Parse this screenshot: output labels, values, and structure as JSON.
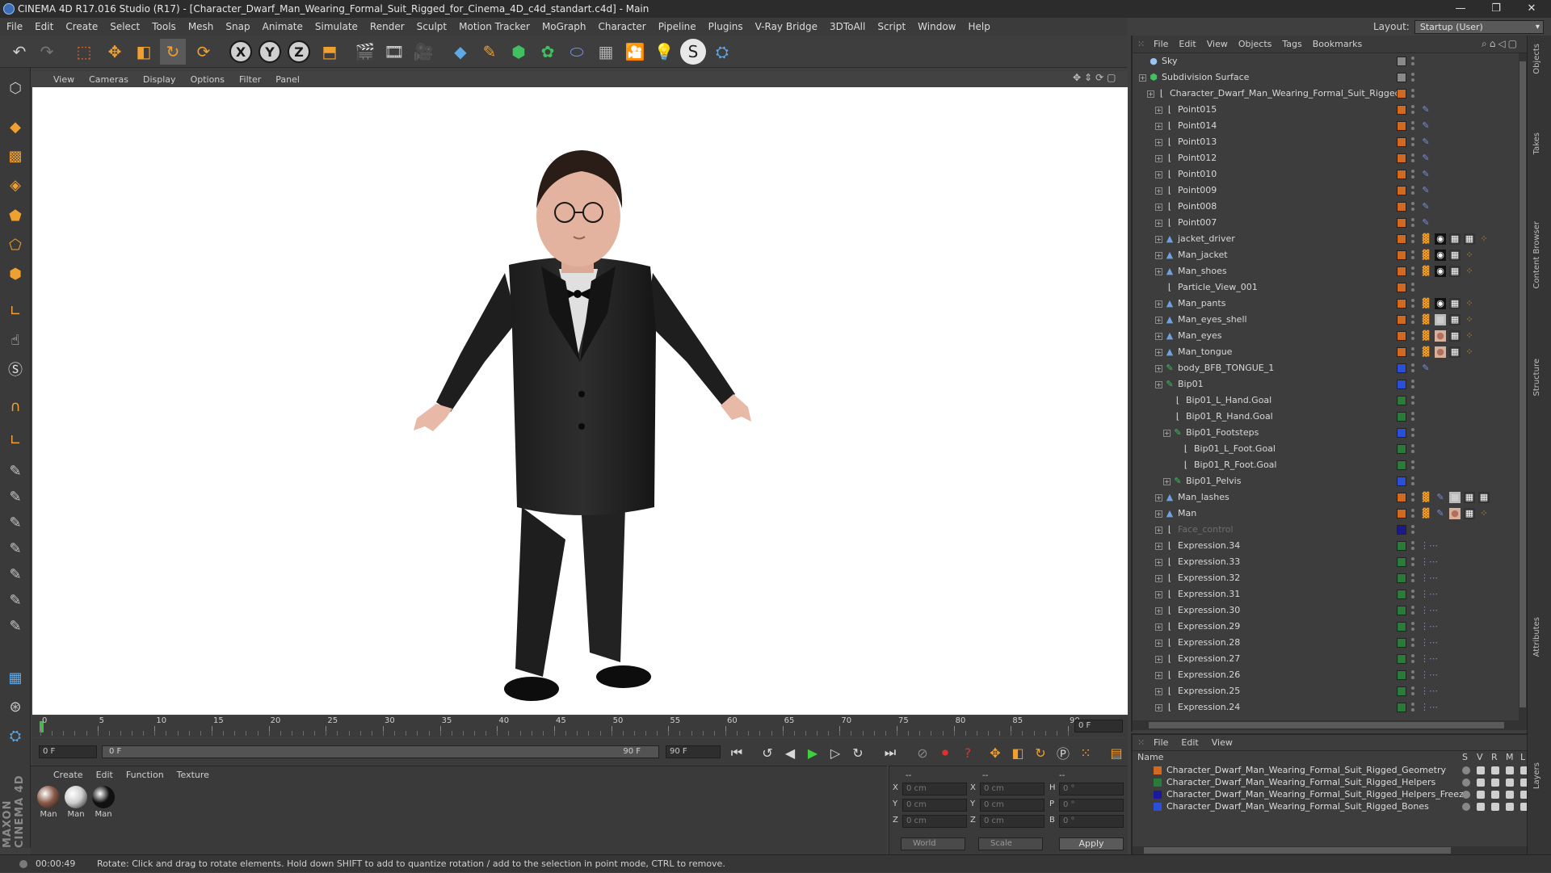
{
  "title_bar": {
    "text": "CINEMA 4D R17.016 Studio (R17) - [Character_Dwarf_Man_Wearing_Formal_Suit_Rigged_for_Cinema_4D_c4d_standart.c4d] - Main"
  },
  "menu": [
    "File",
    "Edit",
    "Create",
    "Select",
    "Tools",
    "Mesh",
    "Snap",
    "Animate",
    "Simulate",
    "Render",
    "Sculpt",
    "Motion Tracker",
    "MoGraph",
    "Character",
    "Pipeline",
    "Plugins",
    "V-Ray Bridge",
    "3DToAll",
    "Script",
    "Window",
    "Help"
  ],
  "layout": {
    "label": "Layout:",
    "value": "Startup (User)"
  },
  "viewport_menu": [
    "View",
    "Cameras",
    "Display",
    "Options",
    "Filter",
    "Panel"
  ],
  "axis_buttons": [
    "X",
    "Y",
    "Z"
  ],
  "timeline": {
    "ticks": [
      "0",
      "5",
      "10",
      "15",
      "20",
      "25",
      "30",
      "35",
      "40",
      "45",
      "50",
      "55",
      "60",
      "65",
      "70",
      "75",
      "80",
      "85",
      "90"
    ],
    "current_frame_field": "0 F"
  },
  "transport": {
    "start_field": "0 F",
    "slider_start": "0 F",
    "slider_end": "90 F",
    "end_field": "90 F"
  },
  "material_manager": {
    "menu": [
      "Create",
      "Edit",
      "Function",
      "Texture"
    ],
    "materials": [
      {
        "label": "Man",
        "color": "#8a5a48"
      },
      {
        "label": "Man",
        "color": "#cfcfcf"
      },
      {
        "label": "Man",
        "color": "#111111"
      }
    ]
  },
  "coordinates": {
    "header_left": "--",
    "header_mid": "--",
    "header_right": "--",
    "rows": [
      {
        "a": "X",
        "av": "0 cm",
        "b": "X",
        "bv": "0 cm",
        "c": "H",
        "cv": "0 °"
      },
      {
        "a": "Y",
        "av": "0 cm",
        "b": "Y",
        "bv": "0 cm",
        "c": "P",
        "cv": "0 °"
      },
      {
        "a": "Z",
        "av": "0 cm",
        "b": "Z",
        "bv": "0 cm",
        "c": "B",
        "cv": "0 °"
      }
    ],
    "mode": "World",
    "scale": "Scale",
    "apply": "Apply"
  },
  "object_manager": {
    "menu": [
      "File",
      "Edit",
      "View",
      "Objects",
      "Tags",
      "Bookmarks"
    ],
    "rows": [
      {
        "name": "Sky",
        "indent": 0,
        "icon": "sky",
        "layer": "",
        "exp": false
      },
      {
        "name": "Subdivision Surface",
        "indent": 0,
        "icon": "subd",
        "layer": "",
        "exp": true
      },
      {
        "name": "Character_Dwarf_Man_Wearing_Formal_Suit_Rigged",
        "indent": 1,
        "icon": "null",
        "layer": "#d2691e",
        "exp": true
      },
      {
        "name": "Point015",
        "indent": 2,
        "icon": "null",
        "layer": "#d2691e",
        "exp": true,
        "tags": [
          "ik"
        ]
      },
      {
        "name": "Point014",
        "indent": 2,
        "icon": "null",
        "layer": "#d2691e",
        "exp": true,
        "tags": [
          "ik"
        ]
      },
      {
        "name": "Point013",
        "indent": 2,
        "icon": "null",
        "layer": "#d2691e",
        "exp": true,
        "tags": [
          "ik"
        ]
      },
      {
        "name": "Point012",
        "indent": 2,
        "icon": "null",
        "layer": "#d2691e",
        "exp": true,
        "tags": [
          "ik"
        ]
      },
      {
        "name": "Point010",
        "indent": 2,
        "icon": "null",
        "layer": "#d2691e",
        "exp": true,
        "tags": [
          "ik"
        ]
      },
      {
        "name": "Point009",
        "indent": 2,
        "icon": "null",
        "layer": "#d2691e",
        "exp": true,
        "tags": [
          "ik"
        ]
      },
      {
        "name": "Point008",
        "indent": 2,
        "icon": "null",
        "layer": "#d2691e",
        "exp": true,
        "tags": [
          "ik"
        ]
      },
      {
        "name": "Point007",
        "indent": 2,
        "icon": "null",
        "layer": "#d2691e",
        "exp": true,
        "tags": [
          "ik"
        ]
      },
      {
        "name": "jacket_driver",
        "indent": 2,
        "icon": "poly",
        "layer": "#d2691e",
        "exp": true,
        "tags": [
          "w",
          "b",
          "k",
          "k",
          "o"
        ]
      },
      {
        "name": "Man_jacket",
        "indent": 2,
        "icon": "poly",
        "layer": "#d2691e",
        "exp": true,
        "tags": [
          "w",
          "b",
          "k",
          "o"
        ]
      },
      {
        "name": "Man_shoes",
        "indent": 2,
        "icon": "poly",
        "layer": "#d2691e",
        "exp": true,
        "tags": [
          "w",
          "b",
          "k",
          "o"
        ]
      },
      {
        "name": "Particle_View_001",
        "indent": 2,
        "icon": "null",
        "layer": "#d2691e",
        "exp": false
      },
      {
        "name": "Man_pants",
        "indent": 2,
        "icon": "poly",
        "layer": "#d2691e",
        "exp": true,
        "tags": [
          "w",
          "b",
          "k",
          "o"
        ]
      },
      {
        "name": "Man_eyes_shell",
        "indent": 2,
        "icon": "poly",
        "layer": "#d2691e",
        "exp": true,
        "tags": [
          "w",
          "g",
          "k",
          "o"
        ]
      },
      {
        "name": "Man_eyes",
        "indent": 2,
        "icon": "poly",
        "layer": "#d2691e",
        "exp": true,
        "tags": [
          "w",
          "s",
          "k",
          "o"
        ]
      },
      {
        "name": "Man_tongue",
        "indent": 2,
        "icon": "poly",
        "layer": "#d2691e",
        "exp": true,
        "tags": [
          "w",
          "s",
          "k",
          "o"
        ]
      },
      {
        "name": "body_BFB_TONGUE_1",
        "indent": 2,
        "icon": "bone",
        "layer": "#2a4fd8",
        "exp": true,
        "tags": [
          "ik"
        ]
      },
      {
        "name": "Bip01",
        "indent": 2,
        "icon": "bone",
        "layer": "#2a4fd8",
        "exp": true
      },
      {
        "name": "Bip01_L_Hand.Goal",
        "indent": 3,
        "icon": "null",
        "layer": "#2a7a3a",
        "exp": false
      },
      {
        "name": "Bip01_R_Hand.Goal",
        "indent": 3,
        "icon": "null",
        "layer": "#2a7a3a",
        "exp": false
      },
      {
        "name": "Bip01_Footsteps",
        "indent": 3,
        "icon": "bone",
        "layer": "#2a4fd8",
        "exp": true
      },
      {
        "name": "Bip01_L_Foot.Goal",
        "indent": 4,
        "icon": "null",
        "layer": "#2a7a3a",
        "exp": false
      },
      {
        "name": "Bip01_R_Foot.Goal",
        "indent": 4,
        "icon": "null",
        "layer": "#2a7a3a",
        "exp": false
      },
      {
        "name": "Bip01_Pelvis",
        "indent": 3,
        "icon": "bone",
        "layer": "#2a4fd8",
        "exp": true
      },
      {
        "name": "Man_lashes",
        "indent": 2,
        "icon": "poly",
        "layer": "#d2691e",
        "exp": true,
        "tags": [
          "w",
          "ik",
          "g",
          "k",
          "k"
        ]
      },
      {
        "name": "Man",
        "indent": 2,
        "icon": "poly",
        "layer": "#d2691e",
        "exp": true,
        "tags": [
          "w",
          "ik",
          "s",
          "k",
          "o"
        ]
      },
      {
        "name": "Face_control",
        "indent": 2,
        "icon": "null",
        "layer": "#1a1a8a",
        "exp": true,
        "dim": true
      },
      {
        "name": "Expression.34",
        "indent": 2,
        "icon": "null",
        "layer": "#2a7a3a",
        "exp": true,
        "tags": [
          "xp"
        ]
      },
      {
        "name": "Expression.33",
        "indent": 2,
        "icon": "null",
        "layer": "#2a7a3a",
        "exp": true,
        "tags": [
          "xp"
        ]
      },
      {
        "name": "Expression.32",
        "indent": 2,
        "icon": "null",
        "layer": "#2a7a3a",
        "exp": true,
        "tags": [
          "xp"
        ]
      },
      {
        "name": "Expression.31",
        "indent": 2,
        "icon": "null",
        "layer": "#2a7a3a",
        "exp": true,
        "tags": [
          "xp"
        ]
      },
      {
        "name": "Expression.30",
        "indent": 2,
        "icon": "null",
        "layer": "#2a7a3a",
        "exp": true,
        "tags": [
          "xp"
        ]
      },
      {
        "name": "Expression.29",
        "indent": 2,
        "icon": "null",
        "layer": "#2a7a3a",
        "exp": true,
        "tags": [
          "xp"
        ]
      },
      {
        "name": "Expression.28",
        "indent": 2,
        "icon": "null",
        "layer": "#2a7a3a",
        "exp": true,
        "tags": [
          "xp"
        ]
      },
      {
        "name": "Expression.27",
        "indent": 2,
        "icon": "null",
        "layer": "#2a7a3a",
        "exp": true,
        "tags": [
          "xp"
        ]
      },
      {
        "name": "Expression.26",
        "indent": 2,
        "icon": "null",
        "layer": "#2a7a3a",
        "exp": true,
        "tags": [
          "xp"
        ]
      },
      {
        "name": "Expression.25",
        "indent": 2,
        "icon": "null",
        "layer": "#2a7a3a",
        "exp": true,
        "tags": [
          "xp"
        ]
      },
      {
        "name": "Expression.24",
        "indent": 2,
        "icon": "null",
        "layer": "#2a7a3a",
        "exp": true,
        "tags": [
          "xp"
        ]
      }
    ]
  },
  "layer_manager": {
    "menu": [
      "File",
      "Edit",
      "View"
    ],
    "name_header": "Name",
    "cols": [
      "S",
      "V",
      "R",
      "M",
      "L"
    ],
    "layers": [
      {
        "name": "Character_Dwarf_Man_Wearing_Formal_Suit_Rigged_Geometry",
        "color": "#d2691e"
      },
      {
        "name": "Character_Dwarf_Man_Wearing_Formal_Suit_Rigged_Helpers",
        "color": "#2a7a3a"
      },
      {
        "name": "Character_Dwarf_Man_Wearing_Formal_Suit_Rigged_Helpers_Freeze",
        "color": "#1a1a9a"
      },
      {
        "name": "Character_Dwarf_Man_Wearing_Formal_Suit_Rigged_Bones",
        "color": "#2a4fd8"
      }
    ]
  },
  "right_tabs": [
    "Objects",
    "Takes",
    "Content Browser",
    "Structure",
    "Attributes",
    "Layers"
  ],
  "status": {
    "time": "00:00:49",
    "message": "Rotate: Click and drag to rotate elements. Hold down SHIFT to add to quantize rotation / add to the selection in point mode, CTRL to remove."
  },
  "logo": "MAXON CINEMA 4D"
}
